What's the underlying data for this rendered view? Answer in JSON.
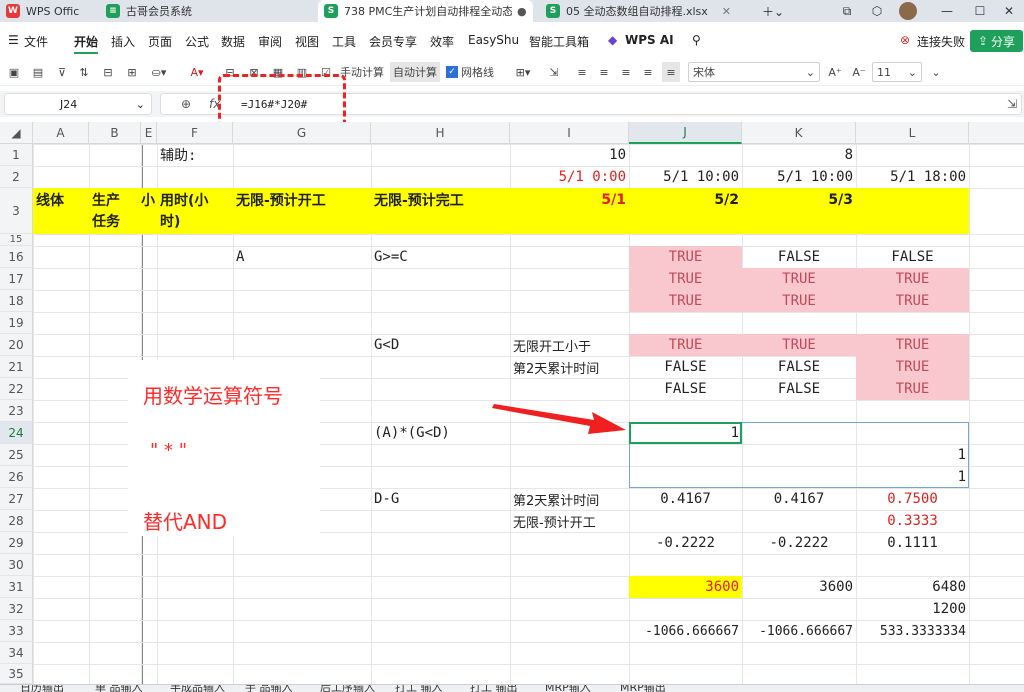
{
  "tabs": [
    {
      "label": "WPS Offic",
      "icon": "W",
      "color": "#e8393a"
    },
    {
      "label": "古哥会员系统",
      "icon": "≡",
      "color": "#1fa05a"
    },
    {
      "label": "738 PMC生产计划自动排程全动态",
      "icon": "S",
      "color": "#1fa05a"
    },
    {
      "label": "05 全动态数组自动排程.xlsx",
      "icon": "S",
      "color": "#1fa05a"
    }
  ],
  "menu": [
    "文件",
    "开始",
    "插入",
    "页面",
    "公式",
    "数据",
    "审阅",
    "视图",
    "工具",
    "会员专享",
    "效率",
    "EasyShu",
    "智能工具箱",
    "WPS AI"
  ],
  "connect_fail": "连接失败",
  "share": "分享",
  "toolbar": {
    "manual_calc": "手动计算",
    "auto_calc": "自动计算",
    "gridlines": "网格线",
    "font_name": "宋体",
    "font_size": "11"
  },
  "namebox": "J24",
  "formula": "=J16#*J20#",
  "columns": [
    "A",
    "B",
    "E",
    "F",
    "G",
    "H",
    "I",
    "J",
    "K",
    "L"
  ],
  "rows": [
    "1",
    "2",
    "3",
    "15",
    "16",
    "17",
    "18",
    "19",
    "20",
    "21",
    "22",
    "23",
    "24",
    "25",
    "26",
    "27",
    "28",
    "29",
    "30",
    "31",
    "32",
    "33",
    "34",
    "35"
  ],
  "cells": {
    "F1": "辅助:",
    "I1": "10",
    "K1": "8",
    "I2": "5/1 0:00",
    "J2": "5/1 10:00",
    "K2": "5/1 10:00",
    "L2": "5/1 18:00",
    "A3": "线体",
    "B3a": "生产",
    "B3b": "任务",
    "E3": "小",
    "F3a": "用时(小",
    "F3b": "时)",
    "G3": "无限-预计开工",
    "H3": "无限-预计完工",
    "I3": "5/1",
    "J3": "5/2",
    "K3": "5/3",
    "G16": "A",
    "H16": "G>=C",
    "J16": "TRUE",
    "K16": "FALSE",
    "L16": "FALSE",
    "J17": "TRUE",
    "K17": "TRUE",
    "L17": "TRUE",
    "J18": "TRUE",
    "K18": "TRUE",
    "L18": "TRUE",
    "H20": "G<D",
    "I20": "无限开工小于",
    "J20": "TRUE",
    "K20": "TRUE",
    "L20": "TRUE",
    "I21": "第2天累计时间",
    "J21": "FALSE",
    "K21": "FALSE",
    "L21": "TRUE",
    "J22": "FALSE",
    "K22": "FALSE",
    "L22": "TRUE",
    "H24": "(A)*(G<D)",
    "J24": "1",
    "L25": "1",
    "L26": "1",
    "H27": "D-G",
    "I27": "第2天累计时间",
    "J27": "0.4167",
    "K27": "0.4167",
    "L27": "0.7500",
    "I28": "无限-预计开工",
    "L28": "0.3333",
    "J29": "-0.2222",
    "K29": "-0.2222",
    "L29": "0.1111",
    "J31": "3600",
    "K31": "3600",
    "L31": "6480",
    "L32": "1200",
    "J33": "-1066.666667",
    "K33": "-1066.666667",
    "L33": "533.3333334"
  },
  "annotation": {
    "line1": "用数学运算符号",
    "line2": "\" * \"",
    "line3": "替代AND"
  },
  "sheet_tabs": [
    "日历输出",
    "单 品输入",
    "半成品输入",
    "手 品输入",
    "后工序输入",
    "打工 输入",
    "打工 输出",
    "MRP输入",
    "MRP输出"
  ]
}
